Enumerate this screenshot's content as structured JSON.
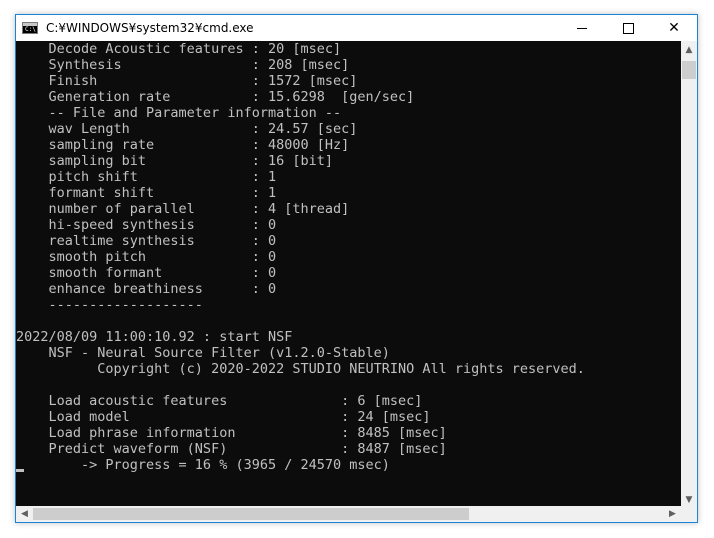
{
  "window": {
    "title": "C:¥WINDOWS¥system32¥cmd.exe",
    "icon_label": "C:\\"
  },
  "controls": {
    "minimize": "minimize-icon",
    "maximize": "maximize-icon",
    "close": "close-icon",
    "close_glyph": "✕"
  },
  "console_lines": [
    "    Decode Acoustic features : 20 [msec]",
    "    Synthesis                : 208 [msec]",
    "    Finish                   : 1572 [msec]",
    "    Generation rate          : 15.6298  [gen/sec]",
    "    -- File and Parameter information --",
    "    wav Length               : 24.57 [sec]",
    "    sampling rate            : 48000 [Hz]",
    "    sampling bit             : 16 [bit]",
    "    pitch shift              : 1",
    "    formant shift            : 1",
    "    number of parallel       : 4 [thread]",
    "    hi-speed synthesis       : 0",
    "    realtime synthesis       : 0",
    "    smooth pitch             : 0",
    "    smooth formant           : 0",
    "    enhance breathiness      : 0",
    "    -------------------",
    "",
    "2022/08/09 11:00:10.92 : start NSF",
    "    NSF - Neural Source Filter (v1.2.0-Stable)",
    "          Copyright (c) 2020-2022 STUDIO NEUTRINO All rights reserved.",
    "",
    "    Load acoustic features              : 6 [msec]",
    "    Load model                          : 24 [msec]",
    "    Load phrase information             : 8485 [msec]",
    "    Predict waveform (NSF)              : 8487 [msec]",
    "        -> Progress = 16 % (3965 / 24570 msec)"
  ],
  "scrollbar": {
    "up_glyph": "▲",
    "down_glyph": "▼",
    "left_glyph": "◀",
    "right_glyph": "▶"
  }
}
